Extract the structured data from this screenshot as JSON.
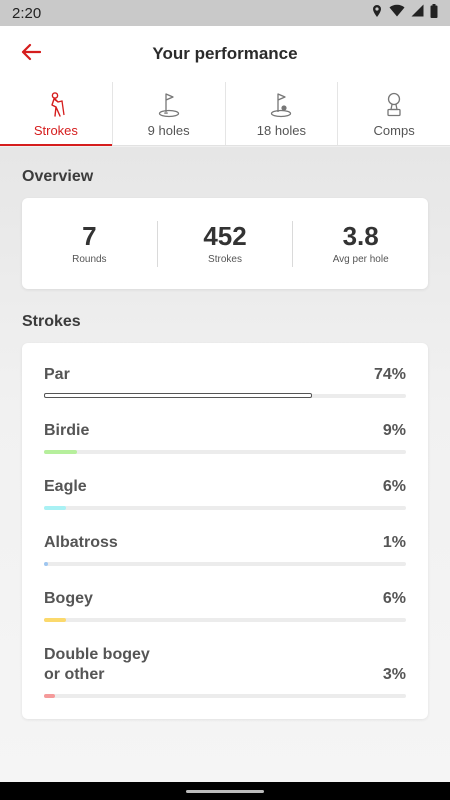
{
  "status_bar": {
    "time": "2:20"
  },
  "header": {
    "title": "Your performance"
  },
  "tabs": [
    {
      "label": "Strokes",
      "icon": "golfer-icon",
      "active": true
    },
    {
      "label": "9 holes",
      "icon": "flag-icon",
      "active": false
    },
    {
      "label": "18 holes",
      "icon": "flag-ball-icon",
      "active": false
    },
    {
      "label": "Comps",
      "icon": "trophy-icon",
      "active": false
    }
  ],
  "overview": {
    "title": "Overview",
    "stats": [
      {
        "value": "7",
        "label": "Rounds"
      },
      {
        "value": "452",
        "label": "Strokes"
      },
      {
        "value": "3.8",
        "label": "Avg per hole"
      }
    ]
  },
  "strokes": {
    "title": "Strokes",
    "items": [
      {
        "name": "Par",
        "percent": "74%",
        "fraction": 0.74,
        "color": "#ffffff",
        "border": "#555555"
      },
      {
        "name": "Birdie",
        "percent": "9%",
        "fraction": 0.09,
        "color": "#b6ef9c"
      },
      {
        "name": "Eagle",
        "percent": "6%",
        "fraction": 0.06,
        "color": "#a9f1f4"
      },
      {
        "name": "Albatross",
        "percent": "1%",
        "fraction": 0.01,
        "color": "#9ec6f0"
      },
      {
        "name": "Bogey",
        "percent": "6%",
        "fraction": 0.06,
        "color": "#fbd96c"
      },
      {
        "name": "Double bogey\nor other",
        "percent": "3%",
        "fraction": 0.03,
        "color": "#f59a9a"
      }
    ]
  },
  "colors": {
    "accent": "#d51d1d"
  }
}
